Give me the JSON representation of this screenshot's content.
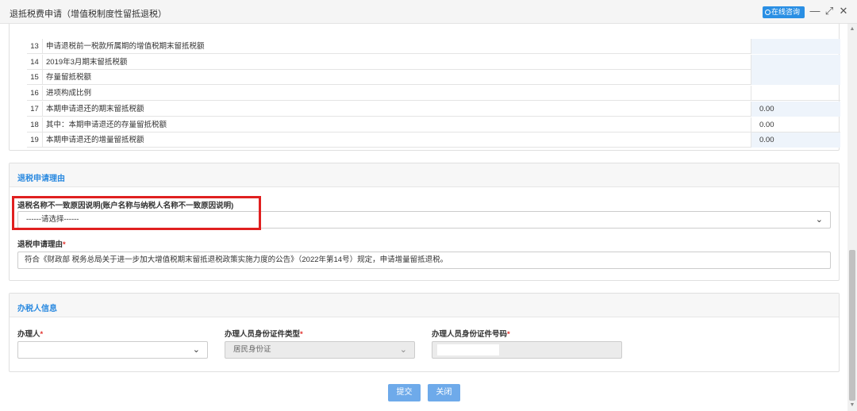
{
  "window": {
    "title": "退抵税费申请（增值税制度性留抵退税）",
    "consult_label": "在线咨询",
    "min_label": "—",
    "max_label": "⤢",
    "close_label": "✕"
  },
  "table": {
    "rows": [
      {
        "num": "13",
        "label": "申请退税前一税款所属期的增值税期末留抵税额",
        "value": "",
        "tint": true
      },
      {
        "num": "14",
        "label": "2019年3月期末留抵税额",
        "value": "",
        "tint": true
      },
      {
        "num": "15",
        "label": "存量留抵税额",
        "value": "",
        "tint": true
      },
      {
        "num": "16",
        "label": "进项构成比例",
        "value": "",
        "tint": false
      },
      {
        "num": "17",
        "label": "本期申请退还的期末留抵税额",
        "value": "0.00",
        "tint": true
      },
      {
        "num": "18",
        "label": "其中：本期申请退还的存量留抵税额",
        "value": "0.00",
        "tint": false
      },
      {
        "num": "19",
        "label": "本期申请退还的增量留抵税额",
        "value": "0.00",
        "tint": true
      }
    ]
  },
  "reason_section": {
    "title": "退税申请理由",
    "mismatch_label": "退税名称不一致原因说明(账户名称与纳税人名称不一致原因说明)",
    "mismatch_select": "------请选择------",
    "reason_label": "退税申请理由",
    "reason_required": "*",
    "reason_value": "符合《财政部 税务总局关于进一步加大增值税期末留抵退税政策实施力度的公告》（2022年第14号）规定，申请增量留抵退税。"
  },
  "handler_section": {
    "title": "办税人信息",
    "handler_label": "办理人",
    "handler_required": "*",
    "handler_value": "",
    "id_type_label": "办理人员身份证件类型",
    "id_type_required": "*",
    "id_type_value": "居民身份证",
    "id_no_label": "办理人员身份证件号码",
    "id_no_required": "*",
    "id_no_value": ""
  },
  "actions": {
    "submit_label": "提交",
    "close_label": "关闭"
  },
  "colors": {
    "accent": "#2b8ae0",
    "button": "#6eaaea",
    "required": "#e2322e",
    "highlight_box": "#e02020"
  }
}
